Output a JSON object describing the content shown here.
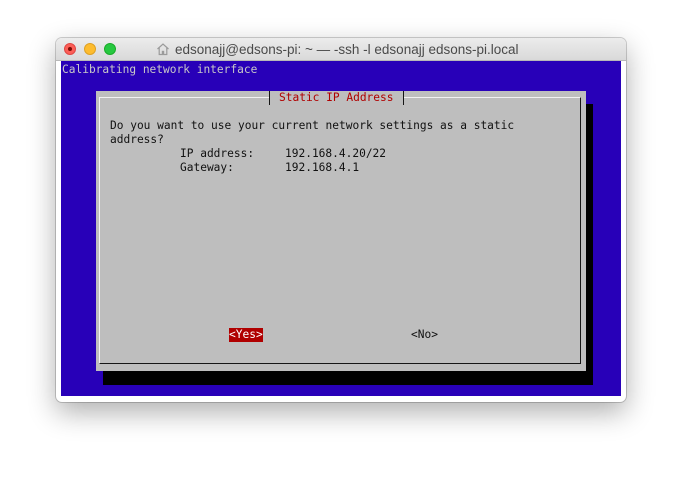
{
  "window": {
    "title": "edsonajj@edsons-pi: ~ — -ssh -l edsonajj edsons-pi.local"
  },
  "terminal": {
    "backtitle": "Calibrating network interface",
    "background_color": "#2800b8"
  },
  "dialog": {
    "title": "Static IP Address",
    "question_line1": "Do you want to use your current network settings as a static",
    "question_line2": "address?",
    "ip_label": "IP address:",
    "ip_value": "192.168.4.20/22",
    "gateway_label": "Gateway:",
    "gateway_value": "192.168.4.1",
    "yes_button": "<Yes>",
    "no_button": "<No>",
    "accent_color": "#b00000"
  },
  "icons": {
    "close": "close-icon",
    "minimize": "minimize-icon",
    "maximize": "maximize-icon",
    "home": "home-icon"
  }
}
